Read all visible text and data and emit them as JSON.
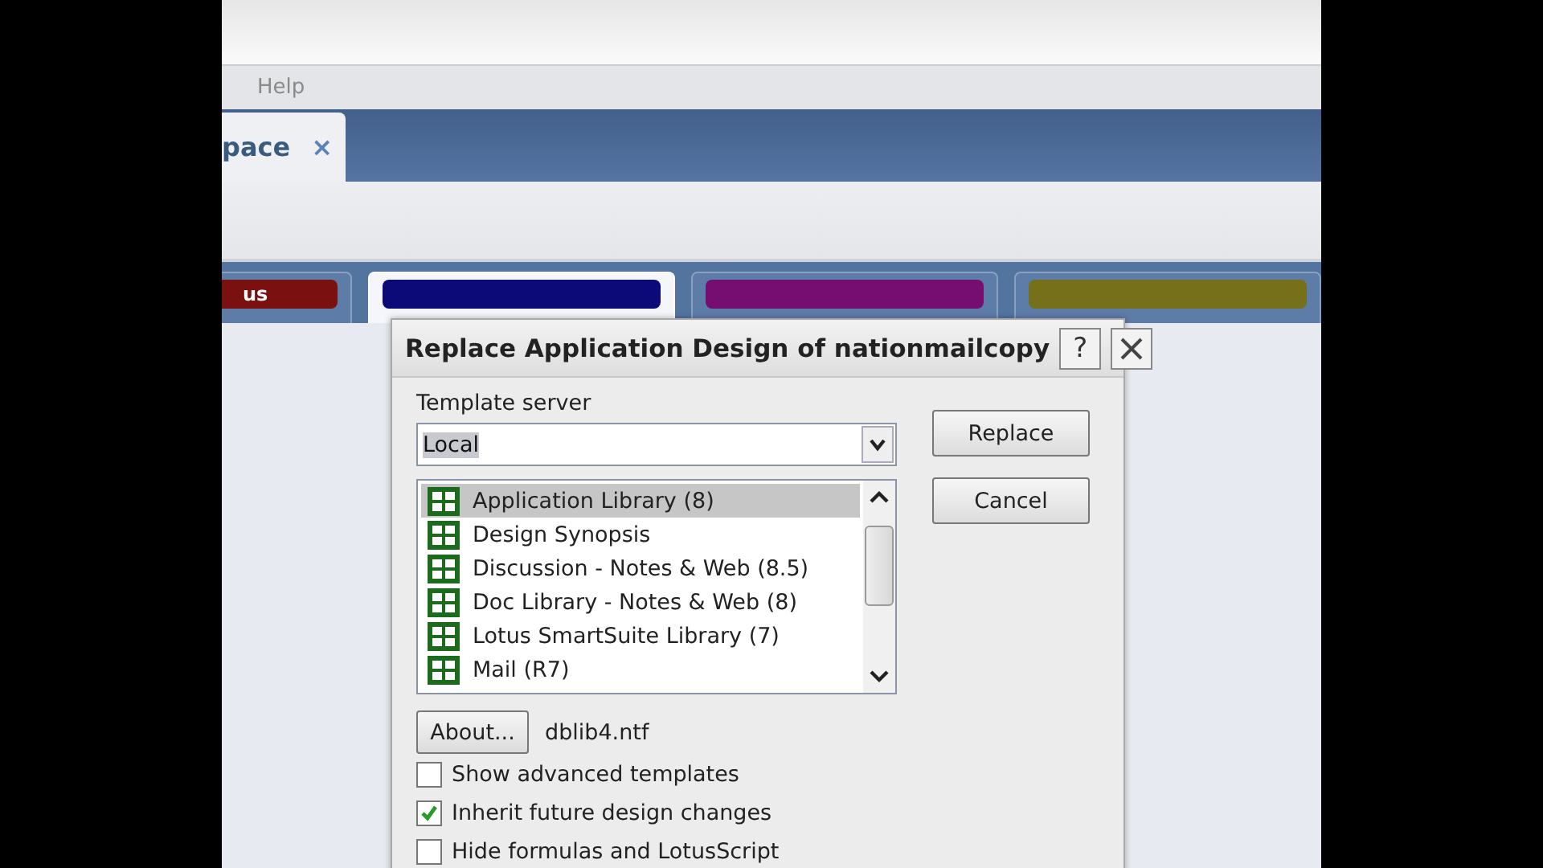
{
  "menu": [
    {
      "label": "Help"
    }
  ],
  "tabs": [
    {
      "label": "pace",
      "close": "×",
      "selected": true
    }
  ],
  "color_tabs": [
    {
      "label": "us",
      "color": "#7a1010",
      "selected": false
    },
    {
      "color": "#0c0a78",
      "selected": true
    },
    {
      "color": "#760e72",
      "selected": false
    },
    {
      "color": "#76701a",
      "selected": false
    }
  ],
  "dialog": {
    "title": "Replace Application Design of nationmailcopy",
    "help_button": "?",
    "template_server": {
      "label": "Template server",
      "value": "Local"
    },
    "templates": [
      {
        "label": "Application Library (8)",
        "selected": true
      },
      {
        "label": "Design Synopsis",
        "selected": false
      },
      {
        "label": "Discussion - Notes & Web (8.5)",
        "selected": false
      },
      {
        "label": "Doc Library - Notes & Web (8)",
        "selected": false
      },
      {
        "label": "Lotus SmartSuite Library (7)",
        "selected": false
      },
      {
        "label": "Mail (R7)",
        "selected": false
      }
    ],
    "buttons": [
      "Replace",
      "Cancel"
    ],
    "about_button": "About...",
    "file_name": "dblib4.ntf",
    "options": [
      {
        "label": "Show advanced templates",
        "checked": false
      },
      {
        "label": "Inherit future design changes",
        "checked": true
      },
      {
        "label": "Hide formulas and LotusScript",
        "checked": false
      }
    ]
  }
}
